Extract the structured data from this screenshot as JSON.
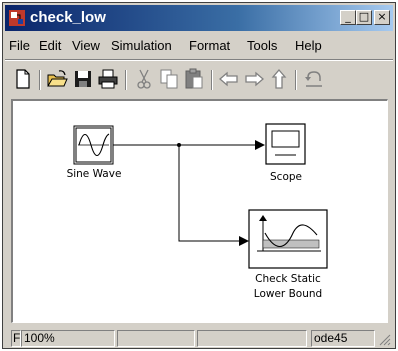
{
  "window": {
    "title": "check_low"
  },
  "menu": [
    "File",
    "Edit",
    "View",
    "Simulation",
    "Format",
    "Tools",
    "Help"
  ],
  "caption_buttons": {
    "minimize": "_",
    "maximize": "□",
    "close": "×"
  },
  "blocks": {
    "sine": {
      "label": "Sine Wave"
    },
    "scope": {
      "label": "Scope"
    },
    "check": {
      "label_line1": "Check Static",
      "label_line2": "Lower Bound"
    }
  },
  "status": {
    "left": "F",
    "zoom": "100%",
    "solver": "ode45"
  },
  "toolbar_icons": [
    "new-icon",
    "open-icon",
    "save-icon",
    "print-icon",
    "cut-icon",
    "copy-icon",
    "paste-icon",
    "back-icon",
    "forward-icon",
    "up-icon",
    "undo-icon"
  ]
}
